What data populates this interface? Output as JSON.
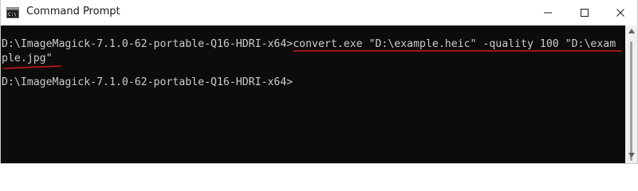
{
  "window": {
    "title": "Command Prompt",
    "app_icon": "cmd-icon",
    "controls": {
      "minimize_icon": "minimize-icon",
      "maximize_icon": "maximize-icon",
      "close_icon": "close-icon"
    }
  },
  "console": {
    "lines": [
      {
        "prompt": "D:\\ImageMagick-7.1.0-62-portable-Q16-HDRI-x64>",
        "command": "convert.exe \"D:\\example.heic\" -quality 100 \"D:\\exam"
      },
      {
        "prompt": "",
        "command": "ple.jpg\""
      },
      {
        "prompt": "D:\\ImageMagick-7.1.0-62-portable-Q16-HDRI-x64>",
        "command": ""
      }
    ],
    "annotation_color": "#d0171b"
  },
  "colors": {
    "console_bg": "#0c0c0c",
    "console_text": "#cccccc",
    "titlebar_bg": "#ffffff"
  }
}
